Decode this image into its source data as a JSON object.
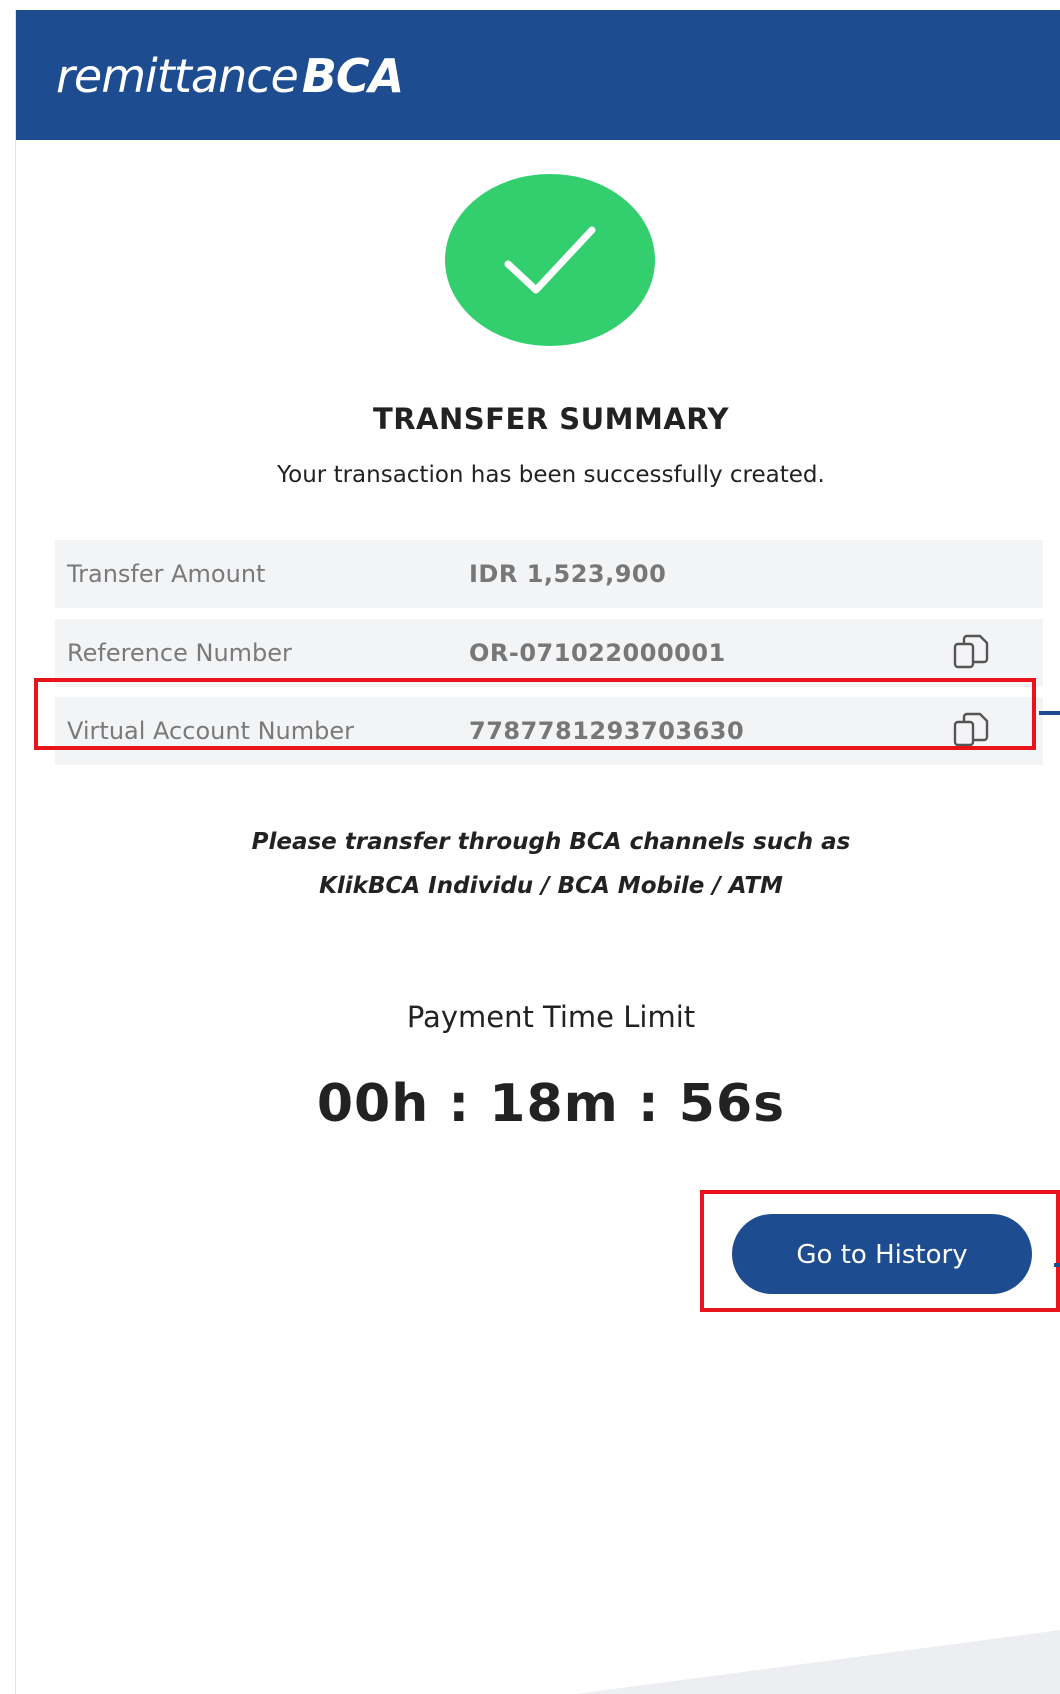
{
  "header": {
    "logo_light": "remittance",
    "logo_bold": "BCA",
    "background": "#1d4c91"
  },
  "status": {
    "icon": "check-icon",
    "color": "#33cf6f",
    "title": "TRANSFER SUMMARY",
    "message": "Your transaction has been successfully created."
  },
  "details": [
    {
      "label": "Transfer Amount",
      "value": "IDR 1,523,900"
    },
    {
      "label": "Reference Number",
      "value": "OR-071022000001",
      "copy_icon": "copy-icon"
    },
    {
      "label": "Virtual Account Number",
      "value": "7787781293703630",
      "copy_icon": "copy-icon"
    }
  ],
  "instructions": {
    "line1": "Please transfer through BCA channels such as",
    "line2": "KlikBCA Individu / BCA Mobile / ATM"
  },
  "time_limit": {
    "label": "Payment Time Limit",
    "countdown": "00h : 18m : 56s"
  },
  "actions": {
    "history_button": "Go to History"
  },
  "annotations": {
    "highlight_color": "#e8141c"
  }
}
